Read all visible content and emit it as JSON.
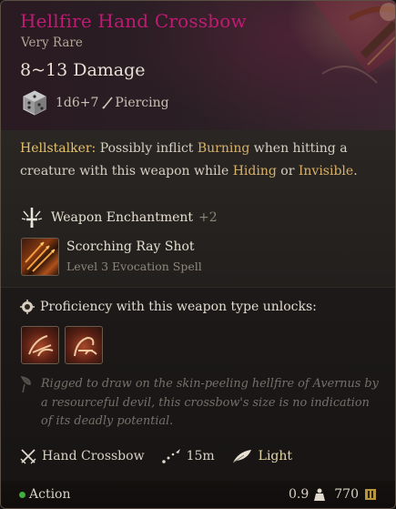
{
  "item": {
    "name": "Hellfire Hand Crossbow",
    "rarity": "Very Rare",
    "damage_range": "8~13 Damage",
    "dice": "1d6+7",
    "damage_type": "Piercing"
  },
  "description": {
    "hellstalker_label": "Hellstalker:",
    "part1": " Possibly inflict ",
    "burning": "Burning",
    "part2": " when hitting a creature with this weapon while ",
    "hiding": "Hiding",
    "part3": " or ",
    "invisible": "Invisible",
    "part4": "."
  },
  "enchantment": {
    "label": "Weapon Enchantment",
    "bonus": "+2"
  },
  "spell": {
    "name": "Scorching Ray Shot",
    "subtitle": "Level 3 Evocation Spell"
  },
  "proficiency": {
    "heading": "Proficiency with this weapon type unlocks:",
    "actions": [
      "piercing-shot-icon",
      "brace-ranged-icon"
    ]
  },
  "flavor_text": "Rigged to draw on the skin-peeling hellfire of Avernus by a resourceful devil, this crossbow's size is no indication of its deadly potential.",
  "properties": {
    "weapon_type": "Hand Crossbow",
    "range": "15m",
    "weight_class": "Light"
  },
  "footer": {
    "action_label": "Action",
    "weight": "0.9",
    "price": "770"
  },
  "colors": {
    "title": "#c01a74",
    "keyword": "#e8c26b",
    "action_dot": "#3fae3a"
  }
}
